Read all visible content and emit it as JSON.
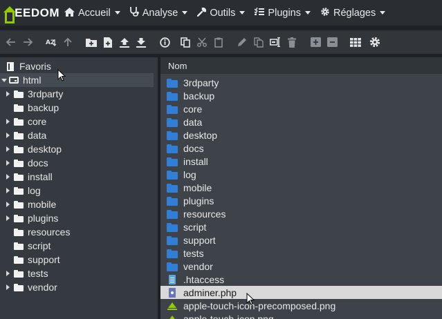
{
  "app": {
    "logo_text": "EEDOM",
    "colors": {
      "brand": "#94ca02",
      "folder": "#2f7ed8",
      "navbar": "#2a2e33",
      "selection": "#d9d9d9"
    }
  },
  "nav": {
    "items": [
      {
        "label": "Accueil",
        "icon": "home-icon"
      },
      {
        "label": "Analyse",
        "icon": "stethoscope-icon"
      },
      {
        "label": "Outils",
        "icon": "wrench-icon"
      },
      {
        "label": "Plugins",
        "icon": "tasks-icon"
      },
      {
        "label": "Réglages",
        "icon": "cogs-icon"
      }
    ]
  },
  "toolbar": {
    "buttons": [
      "back-icon",
      "forward-icon",
      "sort-az-icon",
      "parent-folder-icon",
      "new-folder-icon",
      "new-file-icon",
      "upload-icon",
      "download-icon",
      "info-icon",
      "copy-icon",
      "cut-icon",
      "paste-icon",
      "edit-icon",
      "duplicate-icon",
      "rename-icon",
      "delete-icon",
      "archive-icon",
      "extract-icon",
      "grid-view-icon",
      "settings-icon"
    ]
  },
  "tree": {
    "favorites_label": "Favoris",
    "root_label": "html",
    "folders": [
      {
        "label": "3rdparty",
        "expandable": true
      },
      {
        "label": "backup",
        "expandable": false
      },
      {
        "label": "core",
        "expandable": true
      },
      {
        "label": "data",
        "expandable": true
      },
      {
        "label": "desktop",
        "expandable": true
      },
      {
        "label": "docs",
        "expandable": true
      },
      {
        "label": "install",
        "expandable": true
      },
      {
        "label": "log",
        "expandable": true
      },
      {
        "label": "mobile",
        "expandable": true
      },
      {
        "label": "plugins",
        "expandable": true
      },
      {
        "label": "resources",
        "expandable": false
      },
      {
        "label": "script",
        "expandable": false
      },
      {
        "label": "support",
        "expandable": false
      },
      {
        "label": "tests",
        "expandable": true
      },
      {
        "label": "vendor",
        "expandable": true
      }
    ]
  },
  "files": {
    "column_name": "Nom",
    "rows": [
      {
        "name": "3rdparty",
        "kind": "folder"
      },
      {
        "name": "backup",
        "kind": "folder"
      },
      {
        "name": "core",
        "kind": "folder"
      },
      {
        "name": "data",
        "kind": "folder"
      },
      {
        "name": "desktop",
        "kind": "folder"
      },
      {
        "name": "docs",
        "kind": "folder"
      },
      {
        "name": "install",
        "kind": "folder"
      },
      {
        "name": "log",
        "kind": "folder"
      },
      {
        "name": "mobile",
        "kind": "folder"
      },
      {
        "name": "plugins",
        "kind": "folder"
      },
      {
        "name": "resources",
        "kind": "folder"
      },
      {
        "name": "script",
        "kind": "folder"
      },
      {
        "name": "support",
        "kind": "folder"
      },
      {
        "name": "tests",
        "kind": "folder"
      },
      {
        "name": "vendor",
        "kind": "folder"
      },
      {
        "name": ".htaccess",
        "kind": "doc"
      },
      {
        "name": "adminer.php",
        "kind": "php",
        "selected": true
      },
      {
        "name": "apple-touch-icon-precomposed.png",
        "kind": "img"
      },
      {
        "name": "apple-touch-icon.png",
        "kind": "img"
      }
    ]
  }
}
